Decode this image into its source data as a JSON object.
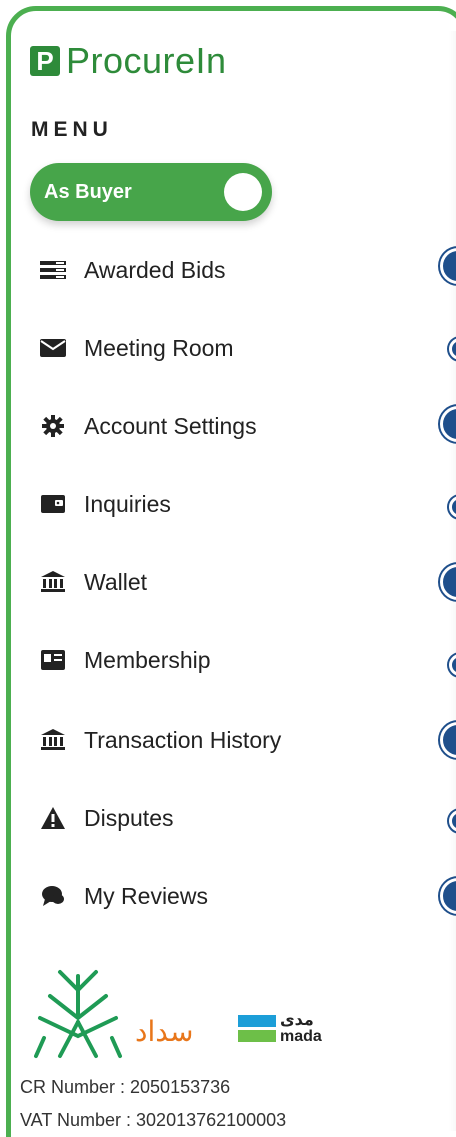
{
  "brand": {
    "logo_letter": "P",
    "name": "ProcureIn",
    "color": "#2e8b3a"
  },
  "menu": {
    "title": "MENU",
    "role_toggle": {
      "label": "As Buyer",
      "on": true,
      "color": "#47a54a"
    },
    "items": [
      {
        "label": "Awarded Bids",
        "icon": "list-icon"
      },
      {
        "label": "Meeting Room",
        "icon": "envelope-icon"
      },
      {
        "label": "Account Settings",
        "icon": "gear-icon"
      },
      {
        "label": "Inquiries",
        "icon": "wallet-card-icon"
      },
      {
        "label": "Wallet",
        "icon": "bank-icon"
      },
      {
        "label": "Membership",
        "icon": "id-card-icon"
      },
      {
        "label": "Transaction History",
        "icon": "bank-icon"
      },
      {
        "label": "Disputes",
        "icon": "warning-icon"
      },
      {
        "label": "My Reviews",
        "icon": "chat-icon"
      }
    ]
  },
  "footer": {
    "payment_logos": {
      "sadad": "سداد",
      "mada_ar": "مدى",
      "mada_en": "mada"
    },
    "cr_number": "CR Number : 2050153736",
    "vat_number": "VAT Number : 302013762100003"
  }
}
